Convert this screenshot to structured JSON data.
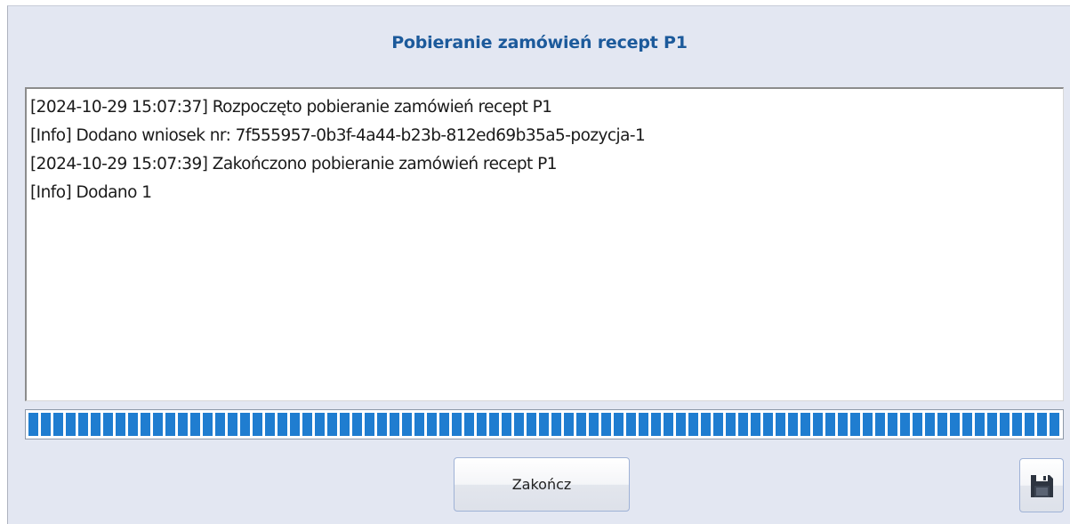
{
  "dialog": {
    "title": "Pobieranie zamówień recept P1"
  },
  "log": {
    "lines": [
      "[2024-10-29 15:07:37] Rozpoczęto pobieranie zamówień recept P1",
      "[Info] Dodano wniosek nr: 7f555957-0b3f-4a44-b23b-812ed69b35a5-pozycja-1",
      "[2024-10-29 15:07:39] Zakończono pobieranie zamówień recept P1",
      "[Info] Dodano 1"
    ]
  },
  "progress": {
    "value_percent": 100,
    "color": "#1f7dd0"
  },
  "buttons": {
    "finish_label": "Zakończ",
    "save_icon": "floppy-disk-icon"
  },
  "colors": {
    "title": "#1c5a9b",
    "dialog_background": "#e3e7f2"
  }
}
